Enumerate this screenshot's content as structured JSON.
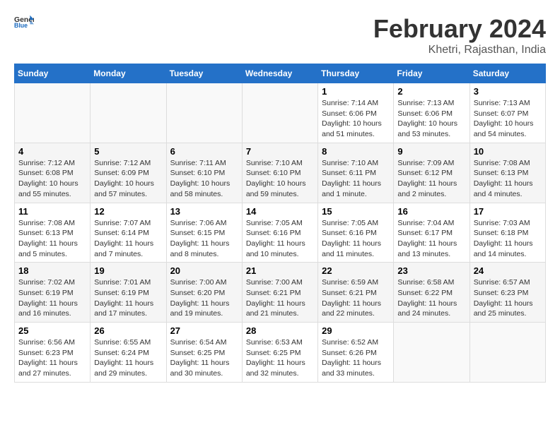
{
  "header": {
    "logo_general": "General",
    "logo_blue": "Blue",
    "title": "February 2024",
    "subtitle": "Khetri, Rajasthan, India"
  },
  "weekdays": [
    "Sunday",
    "Monday",
    "Tuesday",
    "Wednesday",
    "Thursday",
    "Friday",
    "Saturday"
  ],
  "weeks": [
    [
      {
        "day": "",
        "sunrise": "",
        "sunset": "",
        "daylight": "",
        "empty": true
      },
      {
        "day": "",
        "sunrise": "",
        "sunset": "",
        "daylight": "",
        "empty": true
      },
      {
        "day": "",
        "sunrise": "",
        "sunset": "",
        "daylight": "",
        "empty": true
      },
      {
        "day": "",
        "sunrise": "",
        "sunset": "",
        "daylight": "",
        "empty": true
      },
      {
        "day": "1",
        "sunrise": "Sunrise: 7:14 AM",
        "sunset": "Sunset: 6:06 PM",
        "daylight": "Daylight: 10 hours and 51 minutes."
      },
      {
        "day": "2",
        "sunrise": "Sunrise: 7:13 AM",
        "sunset": "Sunset: 6:06 PM",
        "daylight": "Daylight: 10 hours and 53 minutes."
      },
      {
        "day": "3",
        "sunrise": "Sunrise: 7:13 AM",
        "sunset": "Sunset: 6:07 PM",
        "daylight": "Daylight: 10 hours and 54 minutes."
      }
    ],
    [
      {
        "day": "4",
        "sunrise": "Sunrise: 7:12 AM",
        "sunset": "Sunset: 6:08 PM",
        "daylight": "Daylight: 10 hours and 55 minutes."
      },
      {
        "day": "5",
        "sunrise": "Sunrise: 7:12 AM",
        "sunset": "Sunset: 6:09 PM",
        "daylight": "Daylight: 10 hours and 57 minutes."
      },
      {
        "day": "6",
        "sunrise": "Sunrise: 7:11 AM",
        "sunset": "Sunset: 6:10 PM",
        "daylight": "Daylight: 10 hours and 58 minutes."
      },
      {
        "day": "7",
        "sunrise": "Sunrise: 7:10 AM",
        "sunset": "Sunset: 6:10 PM",
        "daylight": "Daylight: 10 hours and 59 minutes."
      },
      {
        "day": "8",
        "sunrise": "Sunrise: 7:10 AM",
        "sunset": "Sunset: 6:11 PM",
        "daylight": "Daylight: 11 hours and 1 minute."
      },
      {
        "day": "9",
        "sunrise": "Sunrise: 7:09 AM",
        "sunset": "Sunset: 6:12 PM",
        "daylight": "Daylight: 11 hours and 2 minutes."
      },
      {
        "day": "10",
        "sunrise": "Sunrise: 7:08 AM",
        "sunset": "Sunset: 6:13 PM",
        "daylight": "Daylight: 11 hours and 4 minutes."
      }
    ],
    [
      {
        "day": "11",
        "sunrise": "Sunrise: 7:08 AM",
        "sunset": "Sunset: 6:13 PM",
        "daylight": "Daylight: 11 hours and 5 minutes."
      },
      {
        "day": "12",
        "sunrise": "Sunrise: 7:07 AM",
        "sunset": "Sunset: 6:14 PM",
        "daylight": "Daylight: 11 hours and 7 minutes."
      },
      {
        "day": "13",
        "sunrise": "Sunrise: 7:06 AM",
        "sunset": "Sunset: 6:15 PM",
        "daylight": "Daylight: 11 hours and 8 minutes."
      },
      {
        "day": "14",
        "sunrise": "Sunrise: 7:05 AM",
        "sunset": "Sunset: 6:16 PM",
        "daylight": "Daylight: 11 hours and 10 minutes."
      },
      {
        "day": "15",
        "sunrise": "Sunrise: 7:05 AM",
        "sunset": "Sunset: 6:16 PM",
        "daylight": "Daylight: 11 hours and 11 minutes."
      },
      {
        "day": "16",
        "sunrise": "Sunrise: 7:04 AM",
        "sunset": "Sunset: 6:17 PM",
        "daylight": "Daylight: 11 hours and 13 minutes."
      },
      {
        "day": "17",
        "sunrise": "Sunrise: 7:03 AM",
        "sunset": "Sunset: 6:18 PM",
        "daylight": "Daylight: 11 hours and 14 minutes."
      }
    ],
    [
      {
        "day": "18",
        "sunrise": "Sunrise: 7:02 AM",
        "sunset": "Sunset: 6:19 PM",
        "daylight": "Daylight: 11 hours and 16 minutes."
      },
      {
        "day": "19",
        "sunrise": "Sunrise: 7:01 AM",
        "sunset": "Sunset: 6:19 PM",
        "daylight": "Daylight: 11 hours and 17 minutes."
      },
      {
        "day": "20",
        "sunrise": "Sunrise: 7:00 AM",
        "sunset": "Sunset: 6:20 PM",
        "daylight": "Daylight: 11 hours and 19 minutes."
      },
      {
        "day": "21",
        "sunrise": "Sunrise: 7:00 AM",
        "sunset": "Sunset: 6:21 PM",
        "daylight": "Daylight: 11 hours and 21 minutes."
      },
      {
        "day": "22",
        "sunrise": "Sunrise: 6:59 AM",
        "sunset": "Sunset: 6:21 PM",
        "daylight": "Daylight: 11 hours and 22 minutes."
      },
      {
        "day": "23",
        "sunrise": "Sunrise: 6:58 AM",
        "sunset": "Sunset: 6:22 PM",
        "daylight": "Daylight: 11 hours and 24 minutes."
      },
      {
        "day": "24",
        "sunrise": "Sunrise: 6:57 AM",
        "sunset": "Sunset: 6:23 PM",
        "daylight": "Daylight: 11 hours and 25 minutes."
      }
    ],
    [
      {
        "day": "25",
        "sunrise": "Sunrise: 6:56 AM",
        "sunset": "Sunset: 6:23 PM",
        "daylight": "Daylight: 11 hours and 27 minutes."
      },
      {
        "day": "26",
        "sunrise": "Sunrise: 6:55 AM",
        "sunset": "Sunset: 6:24 PM",
        "daylight": "Daylight: 11 hours and 29 minutes."
      },
      {
        "day": "27",
        "sunrise": "Sunrise: 6:54 AM",
        "sunset": "Sunset: 6:25 PM",
        "daylight": "Daylight: 11 hours and 30 minutes."
      },
      {
        "day": "28",
        "sunrise": "Sunrise: 6:53 AM",
        "sunset": "Sunset: 6:25 PM",
        "daylight": "Daylight: 11 hours and 32 minutes."
      },
      {
        "day": "29",
        "sunrise": "Sunrise: 6:52 AM",
        "sunset": "Sunset: 6:26 PM",
        "daylight": "Daylight: 11 hours and 33 minutes."
      },
      {
        "day": "",
        "sunrise": "",
        "sunset": "",
        "daylight": "",
        "empty": true
      },
      {
        "day": "",
        "sunrise": "",
        "sunset": "",
        "daylight": "",
        "empty": true
      }
    ]
  ]
}
